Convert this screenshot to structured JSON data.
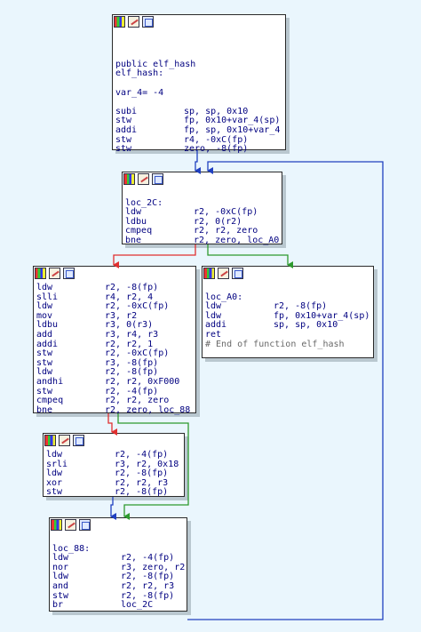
{
  "nodes": [
    {
      "id": "node-entry",
      "lines": [
        {
          "kind": "blank"
        },
        {
          "kind": "blank"
        },
        {
          "kind": "blank"
        },
        {
          "kind": "label",
          "text": "public elf_hash"
        },
        {
          "kind": "label",
          "text": "elf_hash:"
        },
        {
          "kind": "blank"
        },
        {
          "kind": "label",
          "text": "var_4= -4"
        },
        {
          "kind": "blank"
        },
        {
          "kind": "instr",
          "mn": "subi",
          "ops": "sp, sp, 0x10"
        },
        {
          "kind": "instr",
          "mn": "stw",
          "ops": "fp, 0x10+var_4(sp)"
        },
        {
          "kind": "instr",
          "mn": "addi",
          "ops": "fp, sp, 0x10+var_4"
        },
        {
          "kind": "instr",
          "mn": "stw",
          "ops": "r4, -0xC(fp)"
        },
        {
          "kind": "instr",
          "mn": "stw",
          "ops": "zero, -8(fp)"
        }
      ]
    },
    {
      "id": "node-loc-2c",
      "lines": [
        {
          "kind": "blank"
        },
        {
          "kind": "label",
          "text": "loc_2C:"
        },
        {
          "kind": "instr",
          "mn": "ldw",
          "ops": "r2, -0xC(fp)"
        },
        {
          "kind": "instr",
          "mn": "ldbu",
          "ops": "r2, 0(r2)"
        },
        {
          "kind": "instr",
          "mn": "cmpeq",
          "ops": "r2, r2, zero"
        },
        {
          "kind": "instr",
          "mn": "bne",
          "ops": "r2, zero, loc_A0"
        }
      ]
    },
    {
      "id": "node-loop-body",
      "lines": [
        {
          "kind": "instr",
          "mn": "ldw",
          "ops": "r2, -8(fp)"
        },
        {
          "kind": "instr",
          "mn": "slli",
          "ops": "r4, r2, 4"
        },
        {
          "kind": "instr",
          "mn": "ldw",
          "ops": "r2, -0xC(fp)"
        },
        {
          "kind": "instr",
          "mn": "mov",
          "ops": "r3, r2"
        },
        {
          "kind": "instr",
          "mn": "ldbu",
          "ops": "r3, 0(r3)"
        },
        {
          "kind": "instr",
          "mn": "add",
          "ops": "r3, r4, r3"
        },
        {
          "kind": "instr",
          "mn": "addi",
          "ops": "r2, r2, 1"
        },
        {
          "kind": "instr",
          "mn": "stw",
          "ops": "r2, -0xC(fp)"
        },
        {
          "kind": "instr",
          "mn": "stw",
          "ops": "r3, -8(fp)"
        },
        {
          "kind": "instr",
          "mn": "ldw",
          "ops": "r2, -8(fp)"
        },
        {
          "kind": "instr",
          "mn": "andhi",
          "ops": "r2, r2, 0xF000"
        },
        {
          "kind": "instr",
          "mn": "stw",
          "ops": "r2, -4(fp)"
        },
        {
          "kind": "instr",
          "mn": "cmpeq",
          "ops": "r2, r2, zero"
        },
        {
          "kind": "instr",
          "mn": "bne",
          "ops": "r2, zero, loc_88"
        }
      ]
    },
    {
      "id": "node-loc-a0",
      "lines": [
        {
          "kind": "blank"
        },
        {
          "kind": "label",
          "text": "loc_A0:"
        },
        {
          "kind": "instr",
          "mn": "ldw",
          "ops": "r2, -8(fp)"
        },
        {
          "kind": "instr",
          "mn": "ldw",
          "ops": "fp, 0x10+var_4(sp)"
        },
        {
          "kind": "instr",
          "mn": "addi",
          "ops": "sp, sp, 0x10"
        },
        {
          "kind": "instr",
          "mn": "ret",
          "ops": ""
        },
        {
          "kind": "comment",
          "text": "# End of function elf_hash"
        }
      ]
    },
    {
      "id": "node-high-nibble",
      "lines": [
        {
          "kind": "instr",
          "mn": "ldw",
          "ops": "r2, -4(fp)"
        },
        {
          "kind": "instr",
          "mn": "srli",
          "ops": "r3, r2, 0x18"
        },
        {
          "kind": "instr",
          "mn": "ldw",
          "ops": "r2, -8(fp)"
        },
        {
          "kind": "instr",
          "mn": "xor",
          "ops": "r2, r2, r3"
        },
        {
          "kind": "instr",
          "mn": "stw",
          "ops": "r2, -8(fp)"
        }
      ]
    },
    {
      "id": "node-loc-88",
      "lines": [
        {
          "kind": "blank"
        },
        {
          "kind": "label",
          "text": "loc_88:"
        },
        {
          "kind": "instr",
          "mn": "ldw",
          "ops": "r2, -4(fp)"
        },
        {
          "kind": "instr",
          "mn": "nor",
          "ops": "r3, zero, r2"
        },
        {
          "kind": "instr",
          "mn": "ldw",
          "ops": "r2, -8(fp)"
        },
        {
          "kind": "instr",
          "mn": "and",
          "ops": "r2, r2, r3"
        },
        {
          "kind": "instr",
          "mn": "stw",
          "ops": "r2, -8(fp)"
        },
        {
          "kind": "instr",
          "mn": "br",
          "ops": "loc_2C"
        }
      ]
    }
  ],
  "colors": {
    "background": "#eaf6fd",
    "edge_true": "#2e9a2e",
    "edge_false": "#e03030",
    "edge_unconditional": "#2040c0",
    "edge_backloop": "#2040c0"
  }
}
